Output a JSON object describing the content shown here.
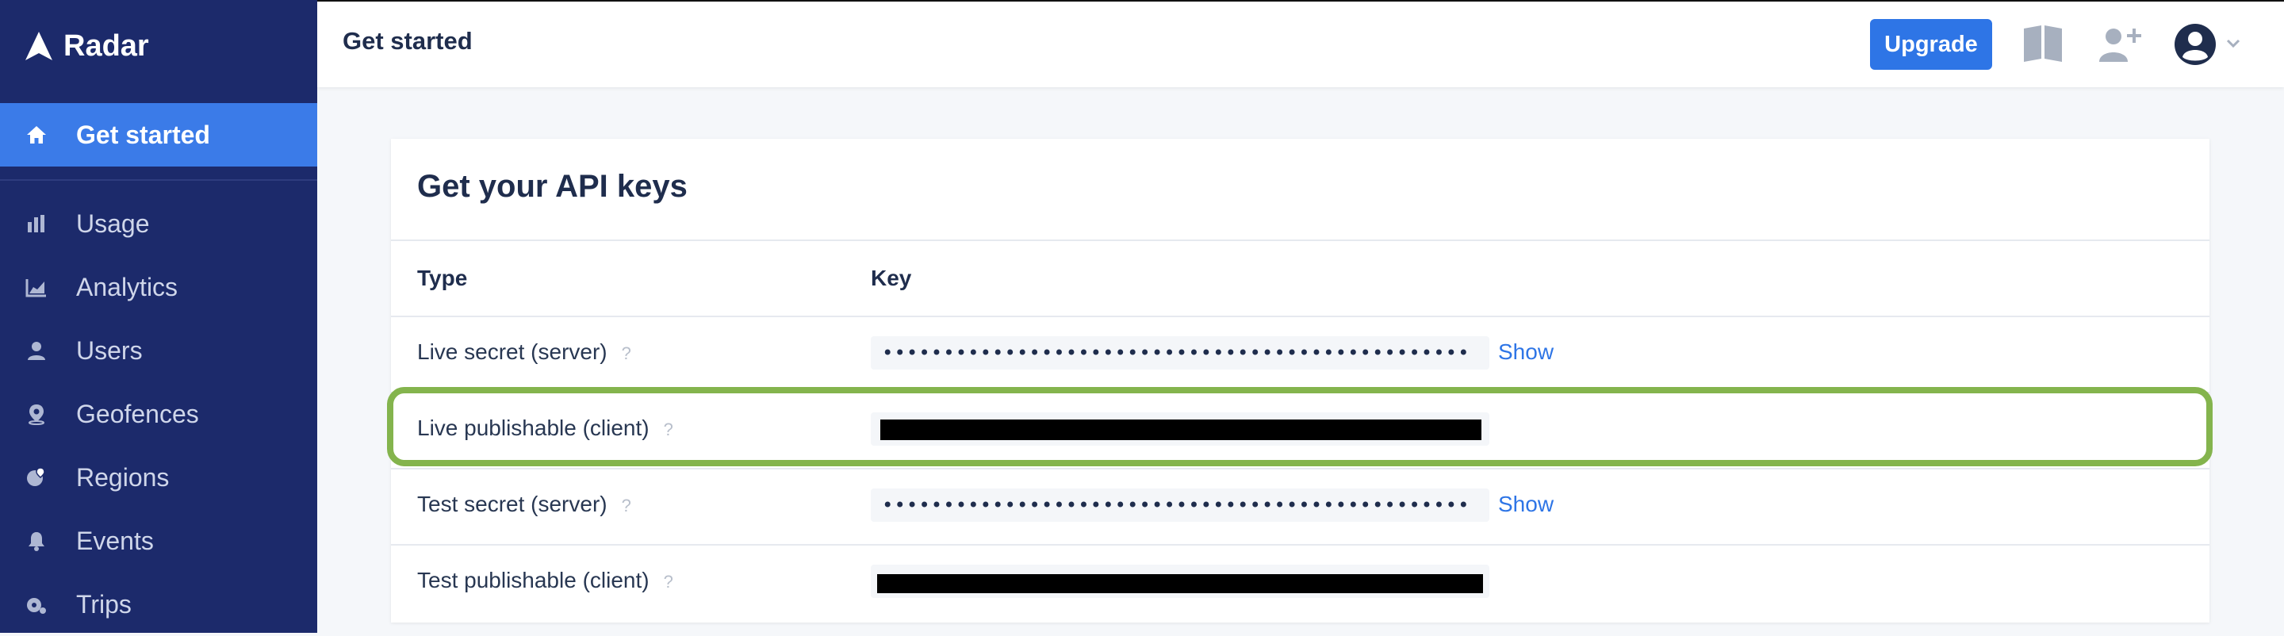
{
  "brand": {
    "name": "Radar"
  },
  "sidebar": {
    "active": {
      "label": "Get started",
      "icon": "home-icon"
    },
    "items": [
      {
        "label": "Usage",
        "icon": "bar-chart-icon"
      },
      {
        "label": "Analytics",
        "icon": "area-chart-icon"
      },
      {
        "label": "Users",
        "icon": "user-icon"
      },
      {
        "label": "Geofences",
        "icon": "map-pin-icon"
      },
      {
        "label": "Regions",
        "icon": "globe-pin-icon"
      },
      {
        "label": "Events",
        "icon": "bell-icon"
      },
      {
        "label": "Trips",
        "icon": "route-icon"
      }
    ]
  },
  "header": {
    "title": "Get started",
    "upgrade_label": "Upgrade",
    "icons": [
      "docs-book-icon",
      "add-user-icon",
      "account-avatar-icon",
      "chevron-down-icon"
    ]
  },
  "card": {
    "title": "Get your API keys",
    "columns": [
      "Type",
      "Key"
    ],
    "rows": [
      {
        "type": "Live secret (server)",
        "help": "?",
        "key": "••••••••••••••••••••••••••••••••••••••••••••••••",
        "action": "Show"
      },
      {
        "type": "Live publishable (client)",
        "help": "?",
        "key": "",
        "action": ""
      },
      {
        "type": "Test secret (server)",
        "help": "?",
        "key": "••••••••••••••••••••••••••••••••••••••••••••••••",
        "action": "Show"
      },
      {
        "type": "Test publishable (client)",
        "help": "?",
        "key": "",
        "action": ""
      }
    ]
  },
  "colors": {
    "sidebar_bg": "#1c2a6b",
    "active_item": "#3b7be8",
    "accent": "#2e75e6",
    "highlight": "#84b44d"
  }
}
